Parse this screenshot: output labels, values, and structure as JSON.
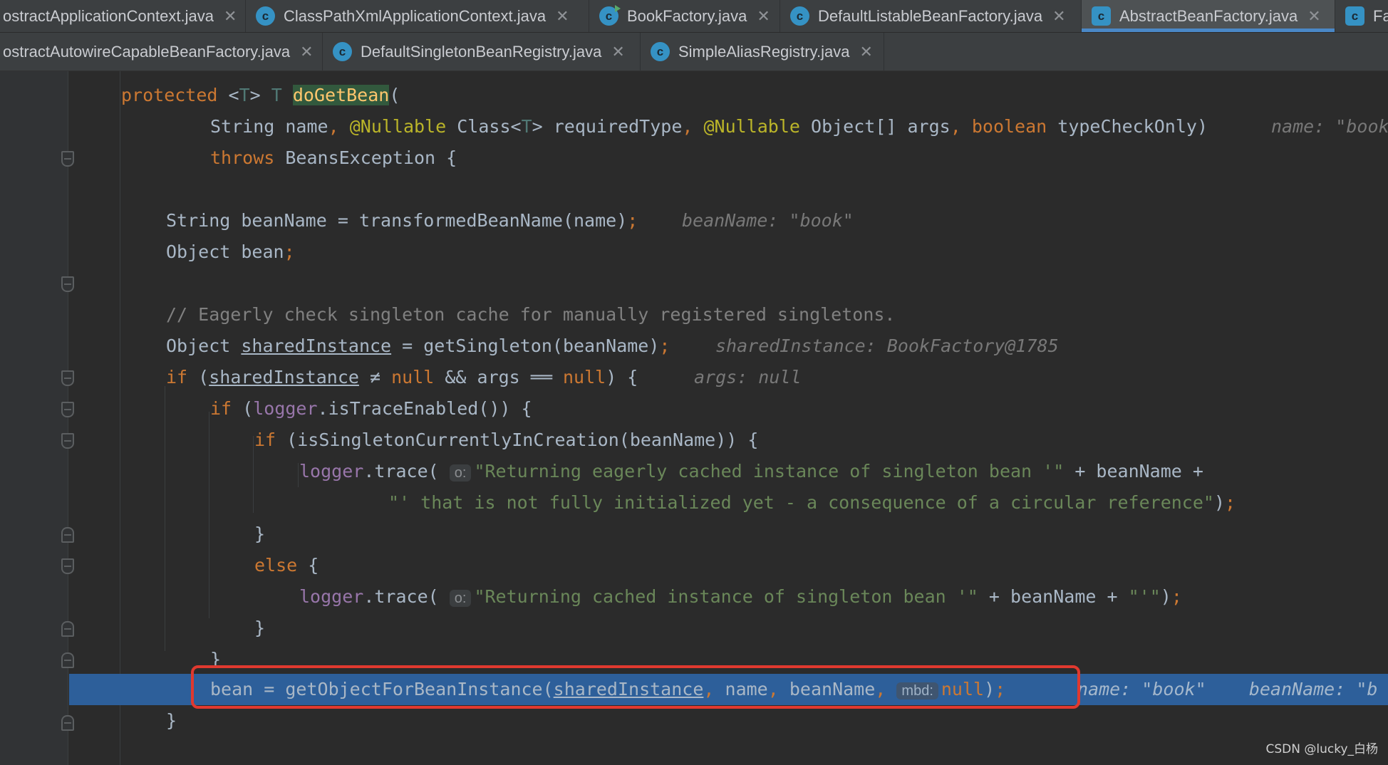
{
  "tabs_row1": [
    {
      "label": "ostractApplicationContext.java",
      "active": false
    },
    {
      "label": "ClassPathXmlApplicationContext.java",
      "active": false
    },
    {
      "label": "BookFactory.java",
      "active": false
    },
    {
      "label": "DefaultListableBeanFactory.java",
      "active": false
    },
    {
      "label": "AbstractBeanFactory.java",
      "active": true
    },
    {
      "label": "Fa",
      "active": false
    }
  ],
  "tabs_row2": [
    {
      "label": "ostractAutowireCapableBeanFactory.java"
    },
    {
      "label": "DefaultSingletonBeanRegistry.java"
    },
    {
      "label": "SimpleAliasRegistry.java"
    }
  ],
  "icons": {
    "class_icon": "class-c-icon",
    "close_icon": "close-icon",
    "fold_icon": "fold-marker-icon"
  },
  "tokens": {
    "protected": "protected",
    "T": "T",
    "doGetBean": "doGetBean",
    "String": "String",
    "name": "name",
    "Nullable": "@Nullable",
    "Class": "Class",
    "requiredType": "requiredType",
    "Object": "Object",
    "args": "args",
    "boolean": "boolean",
    "typeCheckOnly": "typeCheckOnly",
    "throws": "throws",
    "BeansException": "BeansException",
    "beanName": "beanName",
    "transformedBeanName": "transformedBeanName",
    "bean": "bean",
    "sharedInstance": "sharedInstance",
    "getSingleton": "getSingleton",
    "if": "if",
    "null": "null",
    "logger": "logger",
    "isTraceEnabled": "isTraceEnabled",
    "isSingletonCurrentlyInCreation": "isSingletonCurrentlyInCreation",
    "trace": "trace",
    "else": "else",
    "getObjectForBeanInstance": "getObjectForBeanInstance"
  },
  "code": {
    "comment": "// Eagerly check singleton cache for manually registered singletons.",
    "str_eager_1": "\"Returning eagerly cached instance of singleton bean '\"",
    "str_eager_2": "\"' that is not fully initialized yet - a consequence of a circular reference\"",
    "str_cached_1": "\"Returning cached instance of singleton bean '\"",
    "str_cached_2": "\"'\"",
    "pill_o": "o:",
    "pill_mbd": "mbd:"
  },
  "debug_hints": {
    "signature": "name: \"book",
    "beanName": "beanName: \"book\"",
    "sharedInstance": "sharedInstance: BookFactory@1785",
    "args": "args: null",
    "exec_line": "name: \"book\"    beanName: \"b"
  },
  "colors": {
    "editor_bg": "#2b2b2b",
    "keyword": "#cc7832",
    "method_decl": "#ffc66d",
    "annotation": "#bbb529",
    "string": "#6a8759",
    "field": "#9876aa",
    "exec_line_bg": "#2d5f9a",
    "callout_border": "#e0392f",
    "tab_underline": "#4a88c7"
  },
  "watermark": "CSDN @lucky_白杨"
}
